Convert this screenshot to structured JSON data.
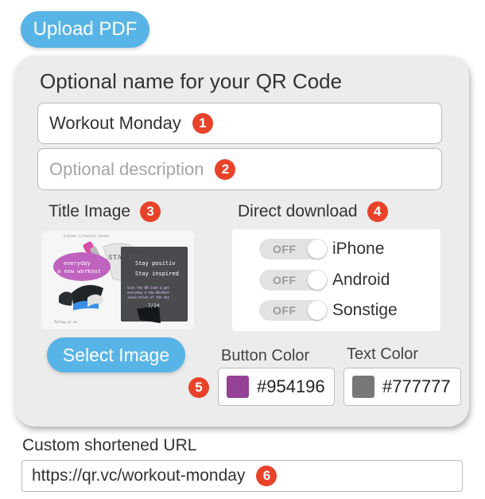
{
  "upload": {
    "label": "Upload PDF"
  },
  "card": {
    "title": "Optional name for your QR Code",
    "name_field": {
      "value": "Workout Monday",
      "badge": "1"
    },
    "description_field": {
      "placeholder": "Optional description",
      "badge": "2"
    },
    "title_image": {
      "label": "Title Image",
      "badge": "3",
      "thumbnail": {
        "header": "Greener Lifestyle Studio",
        "stay_fit": "STAY FIT",
        "bubble_line1": "everyday",
        "bubble_line2": "a new workout",
        "dark_line1": "Stay positiv",
        "dark_line2": "Stay inspired",
        "scan_line1": "Scan the QR Code & get",
        "scan_line2": "everyday a new Workout",
        "scan_line3": "inspiration of the day",
        "hours": "7/24",
        "follow": "follow us on"
      },
      "select_button": "Select Image"
    },
    "direct_download": {
      "label": "Direct download",
      "badge": "4",
      "toggles": [
        {
          "name": "iPhone",
          "state": "OFF"
        },
        {
          "name": "Android",
          "state": "OFF"
        },
        {
          "name": "Sonstige",
          "state": "OFF"
        }
      ]
    },
    "colors": {
      "badge": "5",
      "button_color": {
        "label": "Button Color",
        "value": "#954196"
      },
      "text_color": {
        "label": "Text Color",
        "value": "#777777"
      }
    }
  },
  "url": {
    "label": "Custom shortened URL",
    "value": "https://qr.vc/workout-monday",
    "badge": "6"
  },
  "colors_theme": {
    "accent": "#58b4e6",
    "badge": "#e8432a",
    "card_bg": "#ececec"
  }
}
